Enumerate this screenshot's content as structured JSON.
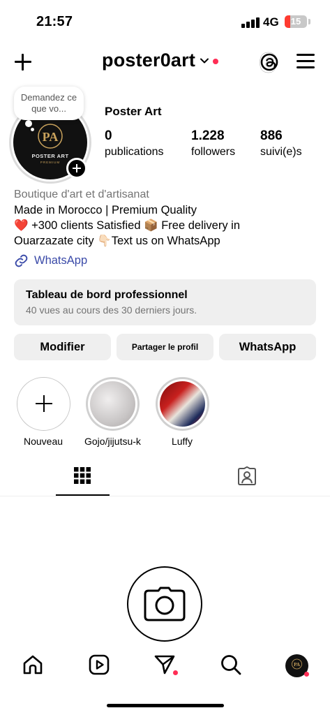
{
  "status_bar": {
    "time": "21:57",
    "network": "4G",
    "battery": "15"
  },
  "header": {
    "username": "poster0art"
  },
  "note": {
    "text": "Demandez ce que vo..."
  },
  "avatar": {
    "logo_initials": "PA",
    "logo_name": "POSTER ART",
    "logo_sub": "PREMIUM"
  },
  "profile": {
    "display_name": "Poster Art",
    "stats": [
      {
        "value": "0",
        "label": "publications"
      },
      {
        "value": "1.228",
        "label": "followers"
      },
      {
        "value": "886",
        "label": "suivi(e)s"
      }
    ],
    "category": "Boutique d'art et d'artisanat",
    "bio": [
      "Made in Morocco | Premium Quality",
      "❤️ +300 clients Satisfied 📦 Free delivery in",
      "Ouarzazate city 👇🏻Text us on WhatsApp"
    ],
    "link": "WhatsApp"
  },
  "dashboard": {
    "title": "Tableau de bord professionnel",
    "subtitle": "40 vues au cours des 30 derniers jours."
  },
  "buttons": {
    "edit": "Modifier",
    "share": "Partager le profil",
    "whatsapp": "WhatsApp"
  },
  "stories": [
    {
      "label": "Nouveau"
    },
    {
      "label": "Gojo/jijutsu-k"
    },
    {
      "label": "Luffy"
    }
  ],
  "icons": {
    "create": "plus-icon",
    "threads": "threads-icon",
    "menu": "hamburger-icon",
    "link": "link-icon",
    "grid_tab": "grid-icon",
    "tagged_tab": "tagged-person-icon",
    "camera": "camera-icon",
    "home": "home-icon",
    "reels": "reels-icon",
    "messages": "paper-plane-icon",
    "search": "search-icon"
  },
  "colors": {
    "accent_link": "#3a4aa8",
    "notification_red": "#ff2d55",
    "button_bg": "#efefef"
  }
}
